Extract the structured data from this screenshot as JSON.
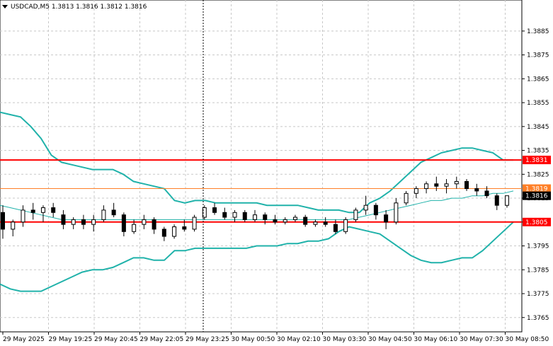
{
  "header": {
    "symbol_line": "USDCAD,M5  1.3813 1.3816 1.3812 1.3816"
  },
  "chart_data": {
    "type": "candlestick",
    "symbol": "USDCAD",
    "timeframe": "M5",
    "ohlc_header": {
      "open": 1.3813,
      "high": 1.3816,
      "low": 1.3812,
      "close": 1.3816
    },
    "ylim": [
      1.3759,
      1.3898
    ],
    "y_ticks": [
      "1.3885",
      "1.3875",
      "1.3865",
      "1.3855",
      "1.3845",
      "1.3835",
      "1.3825",
      "1.3815",
      "1.3805",
      "1.3795",
      "1.3785",
      "1.3775",
      "1.3765"
    ],
    "x_ticks": [
      "29 May 2025",
      "29 May 19:25",
      "29 May 20:45",
      "29 May 22:05",
      "29 May 23:25",
      "30 May 00:50",
      "30 May 02:10",
      "30 May 03:30",
      "30 May 04:50",
      "30 May 06:10",
      "30 May 07:30",
      "30 May 08:50"
    ],
    "grid": true,
    "horizontal_levels": [
      {
        "value": 1.3831,
        "label": "1.3831",
        "color": "#ff0000"
      },
      {
        "value": 1.3819,
        "label": "1.3819",
        "color": "#ff7f27"
      },
      {
        "value": 1.3805,
        "label": "1.3805",
        "color": "#ff0000"
      }
    ],
    "current_price": {
      "value": 1.3816,
      "label": "1.3816",
      "color": "#000000"
    },
    "vertical_marker_label": "29 May 23:25",
    "bollinger_bands": {
      "color": "#20b2aa",
      "upper": [
        1.3851,
        1.385,
        1.3849,
        1.3845,
        1.384,
        1.3833,
        1.383,
        1.3829,
        1.3828,
        1.3827,
        1.3827,
        1.3827,
        1.3825,
        1.3822,
        1.3821,
        1.382,
        1.3819,
        1.3814,
        1.3813,
        1.3814,
        1.3814,
        1.3813,
        1.3813,
        1.3813,
        1.3813,
        1.3813,
        1.3812,
        1.3812,
        1.3812,
        1.3812,
        1.3811,
        1.381,
        1.381,
        1.381,
        1.3809,
        1.3809,
        1.3813,
        1.3815,
        1.3818,
        1.3822,
        1.3826,
        1.383,
        1.3832,
        1.3834,
        1.3835,
        1.3836,
        1.3836,
        1.3835,
        1.3834,
        1.3831,
        1.3831
      ],
      "middle": [
        1.3812,
        1.3811,
        1.381,
        1.3809,
        1.3808,
        1.3807,
        1.3806,
        1.3806,
        1.3806,
        1.3806,
        1.3806,
        1.3806,
        1.3806,
        1.3806,
        1.3806,
        1.3806,
        1.3806,
        1.3806,
        1.3806,
        1.3806,
        1.3806,
        1.3806,
        1.3806,
        1.3806,
        1.3806,
        1.3806,
        1.3806,
        1.3806,
        1.3806,
        1.3806,
        1.3806,
        1.3806,
        1.3806,
        1.3806,
        1.3806,
        1.3807,
        1.3808,
        1.3809,
        1.381,
        1.3811,
        1.3812,
        1.3813,
        1.3814,
        1.3814,
        1.3815,
        1.3815,
        1.3816,
        1.3816,
        1.3817,
        1.3817,
        1.3818
      ],
      "lower": [
        1.3779,
        1.3777,
        1.3776,
        1.3776,
        1.3776,
        1.3778,
        1.378,
        1.3782,
        1.3784,
        1.3785,
        1.3785,
        1.3786,
        1.3788,
        1.379,
        1.379,
        1.3789,
        1.3789,
        1.3793,
        1.3793,
        1.3794,
        1.3794,
        1.3794,
        1.3794,
        1.3794,
        1.3794,
        1.3795,
        1.3795,
        1.3795,
        1.3796,
        1.3796,
        1.3797,
        1.3797,
        1.3798,
        1.3801,
        1.3803,
        1.3802,
        1.3801,
        1.38,
        1.3797,
        1.3794,
        1.3791,
        1.3789,
        1.3788,
        1.3788,
        1.3789,
        1.379,
        1.379,
        1.3793,
        1.3797,
        1.3801,
        1.3805
      ]
    },
    "candles": [
      {
        "o": 1.3809,
        "h": 1.3812,
        "l": 1.3798,
        "c": 1.3802
      },
      {
        "o": 1.3802,
        "h": 1.3806,
        "l": 1.3799,
        "c": 1.3805
      },
      {
        "o": 1.3805,
        "h": 1.3812,
        "l": 1.3803,
        "c": 1.381
      },
      {
        "o": 1.381,
        "h": 1.3813,
        "l": 1.3806,
        "c": 1.3809
      },
      {
        "o": 1.3809,
        "h": 1.3812,
        "l": 1.3805,
        "c": 1.3811
      },
      {
        "o": 1.3811,
        "h": 1.3813,
        "l": 1.3807,
        "c": 1.3809
      },
      {
        "o": 1.3808,
        "h": 1.381,
        "l": 1.3802,
        "c": 1.3804
      },
      {
        "o": 1.3804,
        "h": 1.3807,
        "l": 1.3802,
        "c": 1.3806
      },
      {
        "o": 1.3806,
        "h": 1.3808,
        "l": 1.3802,
        "c": 1.3804
      },
      {
        "o": 1.3804,
        "h": 1.3808,
        "l": 1.3801,
        "c": 1.3806
      },
      {
        "o": 1.3806,
        "h": 1.3812,
        "l": 1.3805,
        "c": 1.381
      },
      {
        "o": 1.381,
        "h": 1.3813,
        "l": 1.3807,
        "c": 1.3808
      },
      {
        "o": 1.3808,
        "h": 1.3809,
        "l": 1.3799,
        "c": 1.3801
      },
      {
        "o": 1.3801,
        "h": 1.3806,
        "l": 1.38,
        "c": 1.3804
      },
      {
        "o": 1.3804,
        "h": 1.3808,
        "l": 1.3802,
        "c": 1.3806
      },
      {
        "o": 1.3806,
        "h": 1.3807,
        "l": 1.38,
        "c": 1.3802
      },
      {
        "o": 1.3802,
        "h": 1.3803,
        "l": 1.3797,
        "c": 1.3799
      },
      {
        "o": 1.3799,
        "h": 1.3804,
        "l": 1.3798,
        "c": 1.3803
      },
      {
        "o": 1.3803,
        "h": 1.3806,
        "l": 1.3801,
        "c": 1.3802
      },
      {
        "o": 1.3802,
        "h": 1.3808,
        "l": 1.3801,
        "c": 1.3807
      },
      {
        "o": 1.3807,
        "h": 1.3812,
        "l": 1.3806,
        "c": 1.3811
      },
      {
        "o": 1.3811,
        "h": 1.3813,
        "l": 1.3808,
        "c": 1.3809
      },
      {
        "o": 1.3809,
        "h": 1.3811,
        "l": 1.3806,
        "c": 1.3807
      },
      {
        "o": 1.3807,
        "h": 1.381,
        "l": 1.3805,
        "c": 1.3809
      },
      {
        "o": 1.3809,
        "h": 1.381,
        "l": 1.3805,
        "c": 1.3806
      },
      {
        "o": 1.3806,
        "h": 1.381,
        "l": 1.3805,
        "c": 1.3808
      },
      {
        "o": 1.3808,
        "h": 1.3809,
        "l": 1.3804,
        "c": 1.3806
      },
      {
        "o": 1.3806,
        "h": 1.3808,
        "l": 1.3804,
        "c": 1.3805
      },
      {
        "o": 1.3805,
        "h": 1.3807,
        "l": 1.3804,
        "c": 1.3806
      },
      {
        "o": 1.3806,
        "h": 1.3808,
        "l": 1.3805,
        "c": 1.3807
      },
      {
        "o": 1.3807,
        "h": 1.3808,
        "l": 1.3803,
        "c": 1.3804
      },
      {
        "o": 1.3804,
        "h": 1.3806,
        "l": 1.3803,
        "c": 1.3805
      },
      {
        "o": 1.3805,
        "h": 1.3807,
        "l": 1.3803,
        "c": 1.3804
      },
      {
        "o": 1.3804,
        "h": 1.3806,
        "l": 1.38,
        "c": 1.3801
      },
      {
        "o": 1.3801,
        "h": 1.3807,
        "l": 1.38,
        "c": 1.3806
      },
      {
        "o": 1.3806,
        "h": 1.3811,
        "l": 1.3805,
        "c": 1.381
      },
      {
        "o": 1.381,
        "h": 1.3816,
        "l": 1.3808,
        "c": 1.3812
      },
      {
        "o": 1.3812,
        "h": 1.3813,
        "l": 1.3806,
        "c": 1.3808
      },
      {
        "o": 1.3808,
        "h": 1.381,
        "l": 1.3802,
        "c": 1.3805
      },
      {
        "o": 1.3805,
        "h": 1.3815,
        "l": 1.3804,
        "c": 1.3813
      },
      {
        "o": 1.3813,
        "h": 1.3818,
        "l": 1.3812,
        "c": 1.3817
      },
      {
        "o": 1.3817,
        "h": 1.382,
        "l": 1.3815,
        "c": 1.3819
      },
      {
        "o": 1.3819,
        "h": 1.3822,
        "l": 1.3817,
        "c": 1.3821
      },
      {
        "o": 1.3821,
        "h": 1.3824,
        "l": 1.3818,
        "c": 1.382
      },
      {
        "o": 1.382,
        "h": 1.3823,
        "l": 1.3817,
        "c": 1.3821
      },
      {
        "o": 1.3821,
        "h": 1.3824,
        "l": 1.3819,
        "c": 1.3822
      },
      {
        "o": 1.3822,
        "h": 1.3823,
        "l": 1.3818,
        "c": 1.3819
      },
      {
        "o": 1.3819,
        "h": 1.3821,
        "l": 1.3816,
        "c": 1.3818
      },
      {
        "o": 1.3818,
        "h": 1.382,
        "l": 1.3815,
        "c": 1.3816
      },
      {
        "o": 1.3816,
        "h": 1.3817,
        "l": 1.381,
        "c": 1.3812
      },
      {
        "o": 1.3812,
        "h": 1.3816,
        "l": 1.3811,
        "c": 1.3816
      }
    ]
  }
}
